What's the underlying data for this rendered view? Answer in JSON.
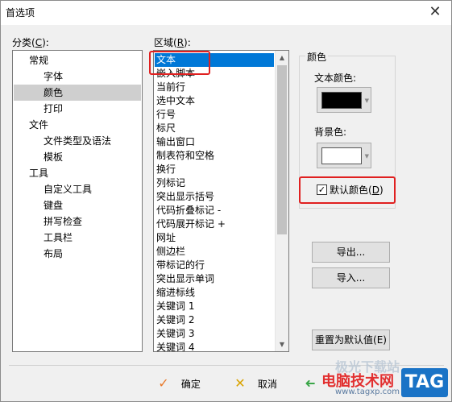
{
  "window": {
    "title": "首选项",
    "close_glyph": "✕"
  },
  "category": {
    "label_prefix": "分类(",
    "label_key": "C",
    "label_suffix": "):",
    "items": [
      {
        "label": "常规"
      },
      {
        "label": "字体"
      },
      {
        "label": "颜色"
      },
      {
        "label": "打印"
      },
      {
        "label": "文件"
      },
      {
        "label": "文件类型及语法"
      },
      {
        "label": "模板"
      },
      {
        "label": "工具"
      },
      {
        "label": "自定义工具"
      },
      {
        "label": "键盘"
      },
      {
        "label": "拼写检查"
      },
      {
        "label": "工具栏"
      },
      {
        "label": "布局"
      }
    ]
  },
  "area": {
    "label_prefix": "区域(",
    "label_key": "R",
    "label_suffix": "):",
    "items": [
      {
        "label": "文本"
      },
      {
        "label": "嵌入脚本"
      },
      {
        "label": "当前行"
      },
      {
        "label": "选中文本"
      },
      {
        "label": "行号"
      },
      {
        "label": "标尺"
      },
      {
        "label": "输出窗口"
      },
      {
        "label": "制表符和空格"
      },
      {
        "label": "换行"
      },
      {
        "label": "列标记"
      },
      {
        "label": "突出显示括号"
      },
      {
        "label": "代码折叠标记 -"
      },
      {
        "label": "代码展开标记 +"
      },
      {
        "label": "网址"
      },
      {
        "label": "侧边栏"
      },
      {
        "label": "带标记的行"
      },
      {
        "label": "突出显示单词"
      },
      {
        "label": "缩进标线"
      },
      {
        "label": "关键词 1"
      },
      {
        "label": "关键词 2"
      },
      {
        "label": "关键词 3"
      },
      {
        "label": "关键词 4"
      }
    ],
    "scroll_up": "▲",
    "scroll_down": "▼"
  },
  "colors": {
    "group_label": "颜色",
    "text_color_label": "文本颜色:",
    "text_color_value": "#000000",
    "bg_color_label": "背景色:",
    "bg_color_value": "#ffffff",
    "dropdown_glyph": "▼",
    "default_prefix": "默认颜色(",
    "default_key": "D",
    "default_suffix": ")",
    "default_checked": true,
    "check_glyph": "✓"
  },
  "buttons": {
    "export": "导出...",
    "import": "导入...",
    "reset": "重置为默认值(E)",
    "ok": "确定",
    "cancel": "取消",
    "ok_glyph": "✓",
    "cancel_glyph": "✕",
    "apply_glyph": "➜"
  },
  "watermark": {
    "line1": "极光下载站",
    "line2": "电脑技术网",
    "url": "www.tagxp.com",
    "tag": "TAG",
    "tag_color": "#1a73c6"
  }
}
